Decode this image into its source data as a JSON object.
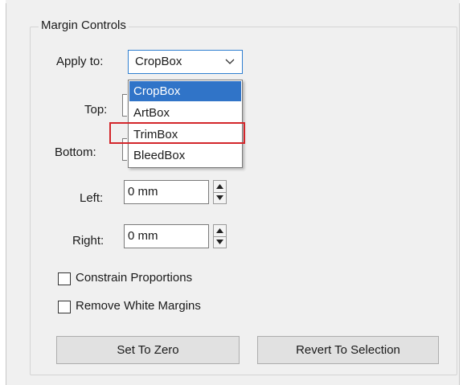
{
  "group": {
    "title": "Margin Controls"
  },
  "apply_to": {
    "label": "Apply to:",
    "selected": "CropBox",
    "options": [
      "CropBox",
      "ArtBox",
      "TrimBox",
      "BleedBox"
    ],
    "highlighted_option": "TrimBox"
  },
  "margins": {
    "top": {
      "label": "Top:"
    },
    "bottom": {
      "label": "Bottom:"
    },
    "left": {
      "label": "Left:",
      "value": "0 mm"
    },
    "right": {
      "label": "Right:",
      "value": "0 mm"
    }
  },
  "options": {
    "constrain": {
      "label": "Constrain Proportions",
      "checked": false
    },
    "remove_white": {
      "label": "Remove White Margins",
      "checked": false
    }
  },
  "buttons": {
    "set_zero": "Set To Zero",
    "revert": "Revert To Selection"
  },
  "colors": {
    "accent": "#3074c8",
    "highlight_outline": "#d3262b",
    "panel_bg": "#f0f0f0"
  }
}
